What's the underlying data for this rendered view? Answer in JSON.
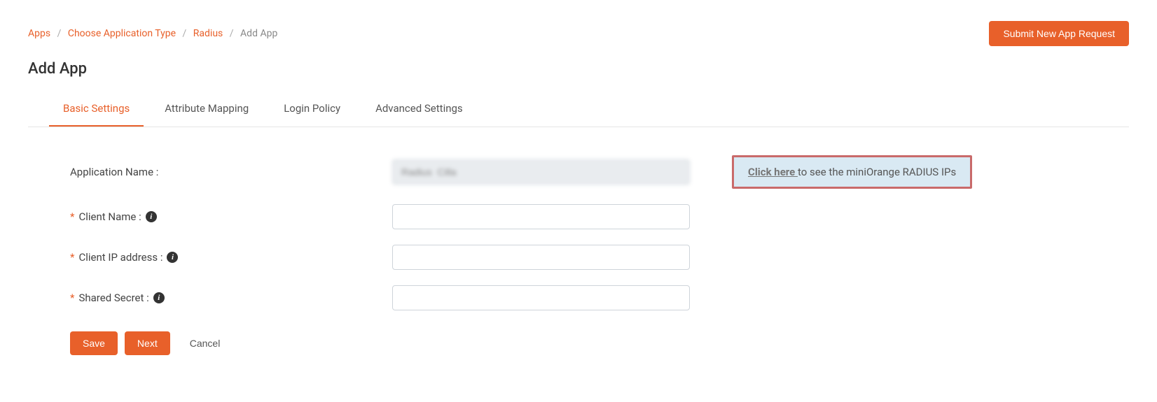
{
  "breadcrumb": {
    "items": [
      "Apps",
      "Choose Application Type",
      "Radius"
    ],
    "current": "Add App"
  },
  "header": {
    "submit_button": "Submit New App Request",
    "title": "Add App"
  },
  "tabs": [
    {
      "label": "Basic Settings",
      "active": true
    },
    {
      "label": "Attribute Mapping",
      "active": false
    },
    {
      "label": "Login Policy",
      "active": false
    },
    {
      "label": "Advanced Settings",
      "active": false
    }
  ],
  "form": {
    "app_name": {
      "label": "Application Name :",
      "value": "Radius  Cilla",
      "required": false
    },
    "client_name": {
      "label": "Client Name :",
      "value": "",
      "required": true
    },
    "client_ip": {
      "label": "Client IP address :",
      "value": "",
      "required": true
    },
    "shared_secret": {
      "label": "Shared Secret :",
      "value": "",
      "required": true
    }
  },
  "info_box": {
    "link_text": "Click here ",
    "rest_text": "to see the miniOrange RADIUS IPs"
  },
  "buttons": {
    "save": "Save",
    "next": "Next",
    "cancel": "Cancel"
  },
  "help_icon": "?"
}
